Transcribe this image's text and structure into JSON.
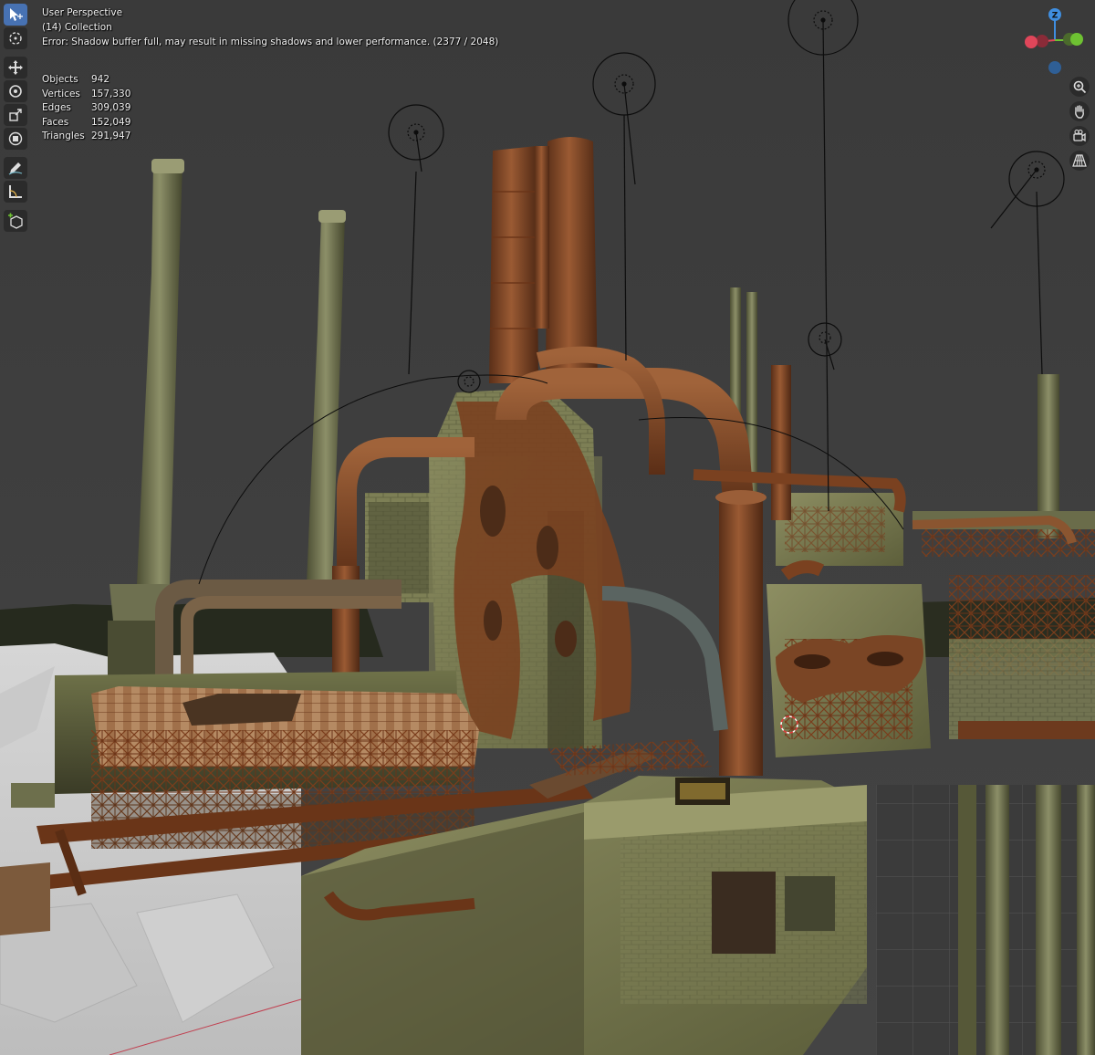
{
  "viewport": {
    "perspective_label": "User Perspective",
    "collection_label": "(14) Collection",
    "error_message": "Error: Shadow buffer full, may result in missing shadows and lower performance. (2377 / 2048)"
  },
  "stats": [
    {
      "label": "Objects",
      "value": "942"
    },
    {
      "label": "Vertices",
      "value": "157,330"
    },
    {
      "label": "Edges",
      "value": "309,039"
    },
    {
      "label": "Faces",
      "value": "152,049"
    },
    {
      "label": "Triangles",
      "value": "291,947"
    }
  ],
  "toolbar": [
    {
      "name": "select-box-tool",
      "icon": "select-cursor-icon",
      "active": true
    },
    {
      "name": "cursor-tool",
      "icon": "3d-cursor-icon",
      "active": false
    },
    {
      "name": "move-tool",
      "icon": "move-arrows-icon",
      "active": false
    },
    {
      "name": "rotate-tool",
      "icon": "rotate-icon",
      "active": false
    },
    {
      "name": "scale-tool",
      "icon": "scale-icon",
      "active": false
    },
    {
      "name": "transform-tool",
      "icon": "transform-icon",
      "active": false
    },
    {
      "name": "annotate-tool",
      "icon": "pencil-icon",
      "active": false
    },
    {
      "name": "measure-tool",
      "icon": "ruler-icon",
      "active": false
    },
    {
      "name": "add-cube-tool",
      "icon": "add-cube-icon",
      "active": false
    }
  ],
  "gizmo": {
    "z_label": "Z",
    "x_color": "#e0465a",
    "y_color": "#6ec232",
    "z_color": "#3f8ee0"
  },
  "nav_buttons": [
    {
      "name": "zoom-button",
      "icon": "magnifier-icon"
    },
    {
      "name": "pan-button",
      "icon": "hand-icon"
    },
    {
      "name": "camera-view-button",
      "icon": "camera-icon"
    },
    {
      "name": "perspective-toggle-button",
      "icon": "grid-perspective-icon"
    }
  ],
  "colors": {
    "background": "#3d3d3d",
    "active_tool": "#4772b3",
    "rust": "#8a4a26",
    "concrete": "#8a8a5c"
  }
}
